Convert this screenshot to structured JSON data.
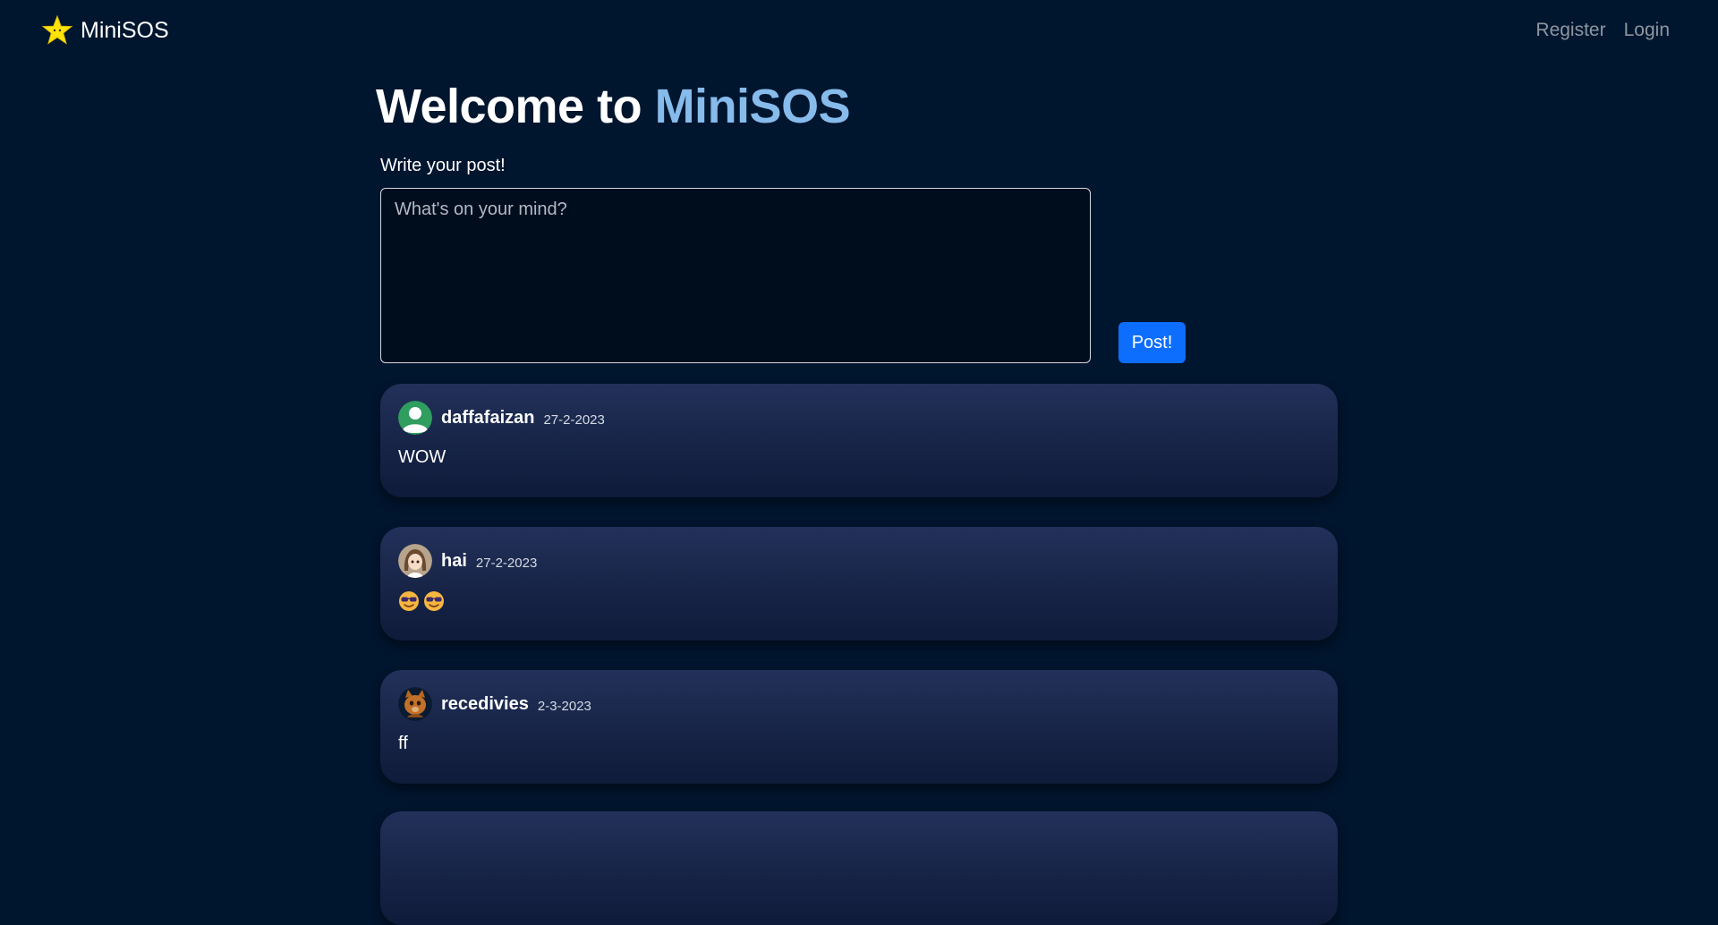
{
  "brand": {
    "name": "MiniSOS",
    "icon": "star-icon",
    "icon_color": "#ffe40a"
  },
  "nav": {
    "register": "Register",
    "login": "Login"
  },
  "title": {
    "prefix": "Welcome to ",
    "accent": "MiniSOS",
    "accent_color": "#86bbeb"
  },
  "compose": {
    "label": "Write your post!",
    "placeholder": "What's on your mind?",
    "value": "",
    "button": "Post!",
    "button_color": "#0d6efd"
  },
  "posts": [
    {
      "author": "daffafaizan",
      "date": "27-2-2023",
      "content": "WOW",
      "avatar": "default-user-avatar"
    },
    {
      "author": "hai",
      "date": "27-2-2023",
      "content": "",
      "content_emoji": [
        "smiling-face-with-sunglasses-emoji",
        "smiling-face-with-sunglasses-emoji"
      ],
      "avatar": "anime-girl-avatar"
    },
    {
      "author": "recedivies",
      "date": "2-3-2023",
      "content": "ff",
      "avatar": "cat-avatar"
    }
  ],
  "colors": {
    "background": "#00152e",
    "card_top": "#22315a",
    "card_bottom": "#0f1b3a"
  }
}
